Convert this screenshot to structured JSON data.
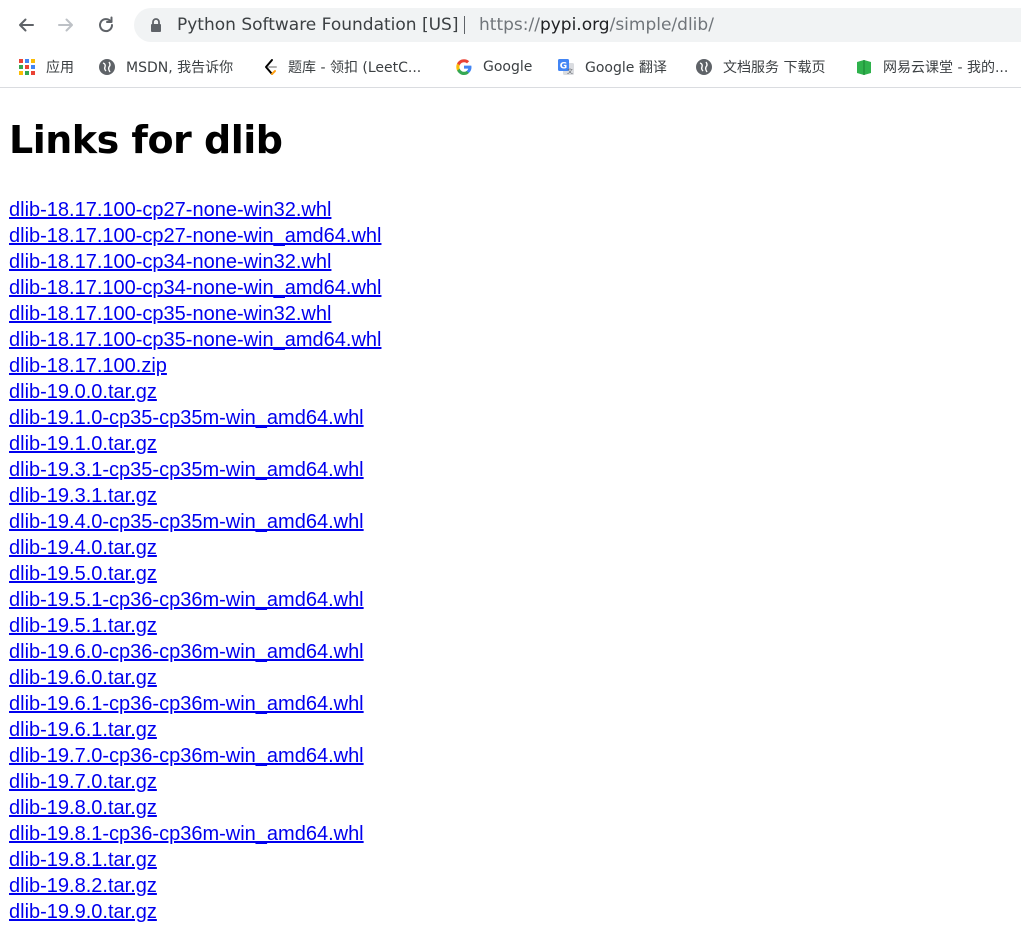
{
  "browser": {
    "omnibox": {
      "org_name": "Python Software Foundation [US]",
      "separator": "|",
      "url_scheme": "https://",
      "url_host": "pypi.org",
      "url_path": "/simple/dlib/"
    },
    "bookmarks": [
      {
        "label": "应用",
        "icon": "apps-grid-icon"
      },
      {
        "label": "MSDN, 我告诉你",
        "icon": "globe-icon"
      },
      {
        "label": "题库 - 领扣 (LeetC...",
        "icon": "leetcode-icon"
      },
      {
        "label": "Google",
        "icon": "google-icon"
      },
      {
        "label": "Google 翻译",
        "icon": "google-translate-icon"
      },
      {
        "label": "文档服务 下载页",
        "icon": "globe-icon"
      },
      {
        "label": "网易云课堂 - 我的...",
        "icon": "netease-icon"
      }
    ]
  },
  "page": {
    "title": "Links for dlib",
    "links": [
      "dlib-18.17.100-cp27-none-win32.whl",
      "dlib-18.17.100-cp27-none-win_amd64.whl",
      "dlib-18.17.100-cp34-none-win32.whl",
      "dlib-18.17.100-cp34-none-win_amd64.whl",
      "dlib-18.17.100-cp35-none-win32.whl",
      "dlib-18.17.100-cp35-none-win_amd64.whl",
      "dlib-18.17.100.zip",
      "dlib-19.0.0.tar.gz",
      "dlib-19.1.0-cp35-cp35m-win_amd64.whl",
      "dlib-19.1.0.tar.gz",
      "dlib-19.3.1-cp35-cp35m-win_amd64.whl",
      "dlib-19.3.1.tar.gz",
      "dlib-19.4.0-cp35-cp35m-win_amd64.whl",
      "dlib-19.4.0.tar.gz",
      "dlib-19.5.0.tar.gz",
      "dlib-19.5.1-cp36-cp36m-win_amd64.whl",
      "dlib-19.5.1.tar.gz",
      "dlib-19.6.0-cp36-cp36m-win_amd64.whl",
      "dlib-19.6.0.tar.gz",
      "dlib-19.6.1-cp36-cp36m-win_amd64.whl",
      "dlib-19.6.1.tar.gz",
      "dlib-19.7.0-cp36-cp36m-win_amd64.whl",
      "dlib-19.7.0.tar.gz",
      "dlib-19.8.0.tar.gz",
      "dlib-19.8.1-cp36-cp36m-win_amd64.whl",
      "dlib-19.8.1.tar.gz",
      "dlib-19.8.2.tar.gz",
      "dlib-19.9.0.tar.gz"
    ]
  },
  "colors": {
    "link": "#0000ee",
    "omnibox_bg": "#f1f3f4",
    "chrome_text": "#3c4043"
  }
}
